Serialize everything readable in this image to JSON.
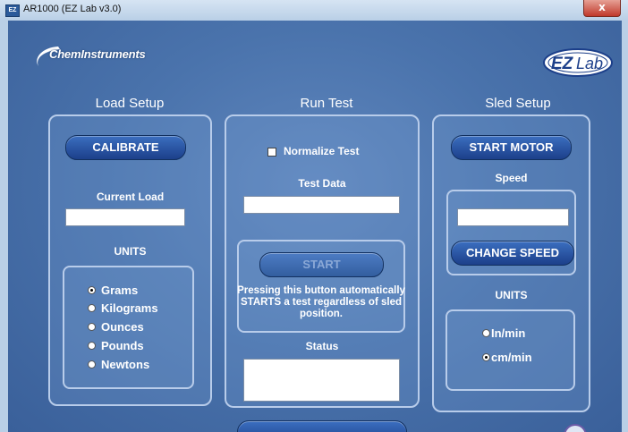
{
  "window": {
    "title": "AR1000 (EZ Lab v3.0)",
    "close_glyph": "x",
    "app_icon_text": "EZ"
  },
  "logos": {
    "chem": "ChemInstruments",
    "ez_prefix": "EZ",
    "ez_suffix": "Lab"
  },
  "load_setup": {
    "title": "Load Setup",
    "calibrate_label": "CALIBRATE",
    "current_load_label": "Current Load",
    "current_load_value": "",
    "units_label": "UNITS",
    "units": [
      {
        "label": "Grams",
        "selected": true
      },
      {
        "label": "Kilograms",
        "selected": false
      },
      {
        "label": "Ounces",
        "selected": false
      },
      {
        "label": "Pounds",
        "selected": false
      },
      {
        "label": "Newtons",
        "selected": false
      }
    ]
  },
  "run_test": {
    "title": "Run Test",
    "normalize_label": "Normalize Test",
    "normalize_checked": false,
    "test_data_label": "Test Data",
    "test_data_value": "",
    "start_label": "START",
    "start_note": "Pressing this button automatically STARTS a test regardless of sled position.",
    "status_label": "Status",
    "status_value": ""
  },
  "sled_setup": {
    "title": "Sled Setup",
    "start_motor_label": "START MOTOR",
    "speed_label": "Speed",
    "speed_value": "",
    "change_speed_label": "CHANGE SPEED",
    "units_label": "UNITS",
    "units": [
      {
        "label": "In/min",
        "selected": false
      },
      {
        "label": "cm/min",
        "selected": true
      }
    ]
  },
  "colors": {
    "background": "#4a73ac",
    "button": "#1c3f8a",
    "panel_border": "#b8ccea"
  }
}
